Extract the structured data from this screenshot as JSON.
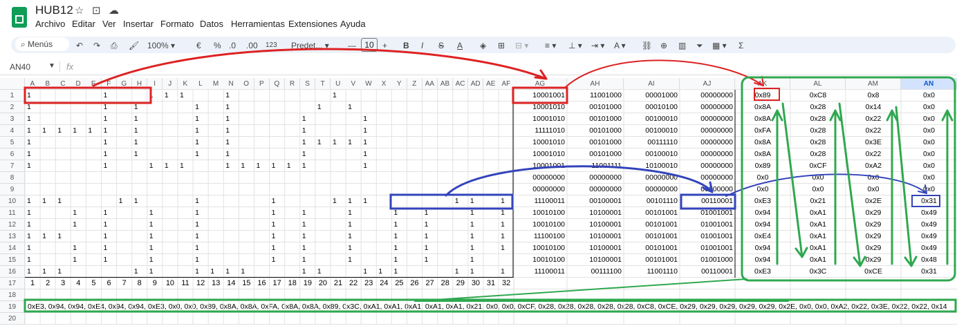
{
  "app": {
    "title": "HUB12",
    "menus": [
      "Archivo",
      "Editar",
      "Ver",
      "Insertar",
      "Formato",
      "Datos",
      "Herramientas",
      "Extensiones",
      "Ayuda"
    ]
  },
  "toolbar": {
    "search": "Menús",
    "zoom": "100%",
    "currency": "€",
    "percent": "%",
    "dec_less": ".0",
    "dec_more": ".00",
    "format_123": "123",
    "font": "Predet...",
    "font_size": "10",
    "bold": "B",
    "italic": "I",
    "strike": "S",
    "text_color": "A",
    "sum": "Σ"
  },
  "formula": {
    "cell_ref": "AN40",
    "fx": "fx"
  },
  "columns": [
    "A",
    "B",
    "C",
    "D",
    "E",
    "F",
    "G",
    "H",
    "I",
    "J",
    "K",
    "L",
    "M",
    "N",
    "O",
    "P",
    "Q",
    "R",
    "S",
    "T",
    "U",
    "V",
    "W",
    "X",
    "Y",
    "Z",
    "AA",
    "AB",
    "AC",
    "AD",
    "AE",
    "AF"
  ],
  "columns_right": [
    "AG",
    "AH",
    "AI",
    "AJ",
    "AK",
    "AL",
    "AM",
    "AN"
  ],
  "bits": [
    [
      1,
      0,
      0,
      0,
      0,
      1,
      0,
      0,
      1,
      1,
      1,
      0,
      0,
      1,
      0,
      0,
      0,
      0,
      0,
      0,
      1,
      0,
      0,
      0,
      0,
      0,
      0,
      0,
      0,
      0,
      0,
      0
    ],
    [
      1,
      0,
      0,
      0,
      0,
      1,
      0,
      1,
      0,
      0,
      0,
      1,
      0,
      1,
      0,
      0,
      0,
      0,
      0,
      1,
      0,
      1,
      0,
      0,
      0,
      0,
      0,
      0,
      0,
      0,
      0,
      0
    ],
    [
      1,
      0,
      0,
      0,
      0,
      1,
      0,
      1,
      0,
      0,
      0,
      1,
      0,
      1,
      0,
      0,
      0,
      0,
      1,
      0,
      0,
      0,
      1,
      0,
      0,
      0,
      0,
      0,
      0,
      0,
      0,
      0
    ],
    [
      1,
      1,
      1,
      1,
      1,
      1,
      0,
      1,
      0,
      0,
      0,
      1,
      0,
      1,
      0,
      0,
      0,
      0,
      1,
      0,
      0,
      0,
      1,
      0,
      0,
      0,
      0,
      0,
      0,
      0,
      0,
      0
    ],
    [
      1,
      0,
      0,
      0,
      0,
      1,
      0,
      1,
      0,
      0,
      0,
      1,
      0,
      1,
      0,
      0,
      0,
      0,
      1,
      1,
      1,
      1,
      1,
      0,
      0,
      0,
      0,
      0,
      0,
      0,
      0,
      0
    ],
    [
      1,
      0,
      0,
      0,
      0,
      1,
      0,
      1,
      0,
      0,
      0,
      1,
      0,
      1,
      0,
      0,
      0,
      0,
      1,
      0,
      0,
      0,
      1,
      0,
      0,
      0,
      0,
      0,
      0,
      0,
      0,
      0
    ],
    [
      1,
      0,
      0,
      0,
      0,
      1,
      0,
      0,
      1,
      1,
      1,
      0,
      0,
      1,
      1,
      1,
      1,
      1,
      1,
      0,
      0,
      0,
      1,
      0,
      0,
      0,
      0,
      0,
      0,
      0,
      0,
      0
    ],
    [
      0,
      0,
      0,
      0,
      0,
      0,
      0,
      0,
      0,
      0,
      0,
      0,
      0,
      0,
      0,
      0,
      0,
      0,
      0,
      0,
      0,
      0,
      0,
      0,
      0,
      0,
      0,
      0,
      0,
      0,
      0,
      0
    ],
    [
      0,
      0,
      0,
      0,
      0,
      0,
      0,
      0,
      0,
      0,
      0,
      0,
      0,
      0,
      0,
      0,
      0,
      0,
      0,
      0,
      0,
      0,
      0,
      0,
      0,
      0,
      0,
      0,
      0,
      0,
      0,
      0
    ],
    [
      1,
      1,
      1,
      0,
      0,
      0,
      1,
      1,
      0,
      0,
      0,
      1,
      0,
      0,
      0,
      0,
      1,
      0,
      0,
      0,
      1,
      1,
      1,
      0,
      0,
      0,
      0,
      0,
      1,
      1,
      0,
      1
    ],
    [
      1,
      0,
      0,
      1,
      0,
      1,
      0,
      0,
      1,
      0,
      0,
      1,
      0,
      0,
      0,
      0,
      1,
      0,
      1,
      0,
      0,
      1,
      0,
      0,
      1,
      0,
      1,
      0,
      0,
      1,
      0,
      1
    ],
    [
      1,
      0,
      0,
      1,
      0,
      1,
      0,
      0,
      1,
      0,
      0,
      1,
      0,
      0,
      0,
      0,
      1,
      0,
      1,
      0,
      0,
      1,
      0,
      0,
      1,
      0,
      1,
      0,
      0,
      1,
      0,
      1
    ],
    [
      1,
      1,
      1,
      0,
      0,
      1,
      0,
      0,
      1,
      0,
      0,
      1,
      0,
      0,
      0,
      0,
      1,
      0,
      1,
      0,
      0,
      1,
      0,
      0,
      1,
      0,
      1,
      0,
      0,
      1,
      0,
      1
    ],
    [
      1,
      0,
      0,
      1,
      0,
      1,
      0,
      0,
      1,
      0,
      0,
      1,
      0,
      0,
      0,
      0,
      1,
      0,
      1,
      0,
      0,
      1,
      0,
      0,
      1,
      0,
      1,
      0,
      0,
      1,
      0,
      1
    ],
    [
      1,
      0,
      0,
      1,
      0,
      1,
      0,
      0,
      1,
      0,
      0,
      1,
      0,
      0,
      0,
      0,
      1,
      0,
      1,
      0,
      0,
      1,
      0,
      0,
      1,
      0,
      1,
      0,
      0,
      1,
      0,
      0
    ],
    [
      1,
      1,
      1,
      0,
      0,
      0,
      0,
      1,
      1,
      0,
      0,
      1,
      1,
      1,
      1,
      0,
      0,
      0,
      1,
      1,
      0,
      0,
      1,
      1,
      1,
      0,
      0,
      0,
      1,
      1,
      0,
      1
    ]
  ],
  "binary": [
    [
      "10001001",
      "11001000",
      "00001000",
      "00000000"
    ],
    [
      "10001010",
      "00101000",
      "00010100",
      "00000000"
    ],
    [
      "10001010",
      "00101000",
      "00100010",
      "00000000"
    ],
    [
      "11111010",
      "00101000",
      "00100010",
      "00000000"
    ],
    [
      "10001010",
      "00101000",
      "00111110",
      "00000000"
    ],
    [
      "10001010",
      "00101000",
      "00100010",
      "00000000"
    ],
    [
      "10001001",
      "11001111",
      "10100010",
      "00000000"
    ],
    [
      "00000000",
      "00000000",
      "00000000",
      "00000000"
    ],
    [
      "00000000",
      "00000000",
      "00000000",
      "00000000"
    ],
    [
      "11100011",
      "00100001",
      "00101110",
      "00110001"
    ],
    [
      "10010100",
      "10100001",
      "00101001",
      "01001001"
    ],
    [
      "10010100",
      "10100001",
      "00101001",
      "01001001"
    ],
    [
      "11100100",
      "10100001",
      "00101001",
      "01001001"
    ],
    [
      "10010100",
      "10100001",
      "00101001",
      "01001001"
    ],
    [
      "10010100",
      "10100001",
      "00101001",
      "01001000"
    ],
    [
      "11100011",
      "00111100",
      "11001110",
      "00110001"
    ]
  ],
  "hex": [
    [
      "0x89",
      "0xC8",
      "0x8",
      "0x0"
    ],
    [
      "0x8A",
      "0x28",
      "0x14",
      "0x0"
    ],
    [
      "0x8A",
      "0x28",
      "0x22",
      "0x0"
    ],
    [
      "0xFA",
      "0x28",
      "0x22",
      "0x0"
    ],
    [
      "0x8A",
      "0x28",
      "0x3E",
      "0x0"
    ],
    [
      "0x8A",
      "0x28",
      "0x22",
      "0x0"
    ],
    [
      "0x89",
      "0xCF",
      "0xA2",
      "0x0"
    ],
    [
      "0x0",
      "0x0",
      "0x0",
      "0x0"
    ],
    [
      "0x0",
      "0x0",
      "0x0",
      "0x0"
    ],
    [
      "0xE3",
      "0x21",
      "0x2E",
      "0x31"
    ],
    [
      "0x94",
      "0xA1",
      "0x29",
      "0x49"
    ],
    [
      "0x94",
      "0xA1",
      "0x29",
      "0x49"
    ],
    [
      "0xE4",
      "0xA1",
      "0x29",
      "0x49"
    ],
    [
      "0x94",
      "0xA1",
      "0x29",
      "0x49"
    ],
    [
      "0x94",
      "0xA1",
      "0x29",
      "0x48"
    ],
    [
      "0xE3",
      "0x3C",
      "0xCE",
      "0x31"
    ]
  ],
  "row17": [
    "1",
    "2",
    "3",
    "4",
    "5",
    "6",
    "7",
    "8",
    "9",
    "10",
    "11",
    "12",
    "13",
    "14",
    "15",
    "16",
    "17",
    "18",
    "19",
    "20",
    "21",
    "22",
    "23",
    "24",
    "25",
    "26",
    "27",
    "28",
    "29",
    "30",
    "31",
    "32"
  ],
  "row19": "0xE3, 0x94, 0x94, 0xE4, 0x94, 0x94, 0xE3, 0x0, 0x0, 0x89, 0x8A, 0x8A, 0xFA, 0x8A, 0x8A, 0x89, 0x3C, 0xA1, 0xA1, 0xA1, 0xA1, 0xA1, 0x21, 0x0, 0x0, 0xCF, 0x28, 0x28, 0x28, 0x28, 0x28, 0xC8, 0xCE, 0x29, 0x29, 0x29, 0x29, 0x29, 0x2E, 0x0, 0x0, 0xA2, 0x22, 0x3E, 0x22, 0x22, 0x14",
  "colors": {
    "red": "#dd2222",
    "blue": "#3344bb",
    "green": "#2fa84f",
    "selected_header": "#d3e3fd"
  }
}
